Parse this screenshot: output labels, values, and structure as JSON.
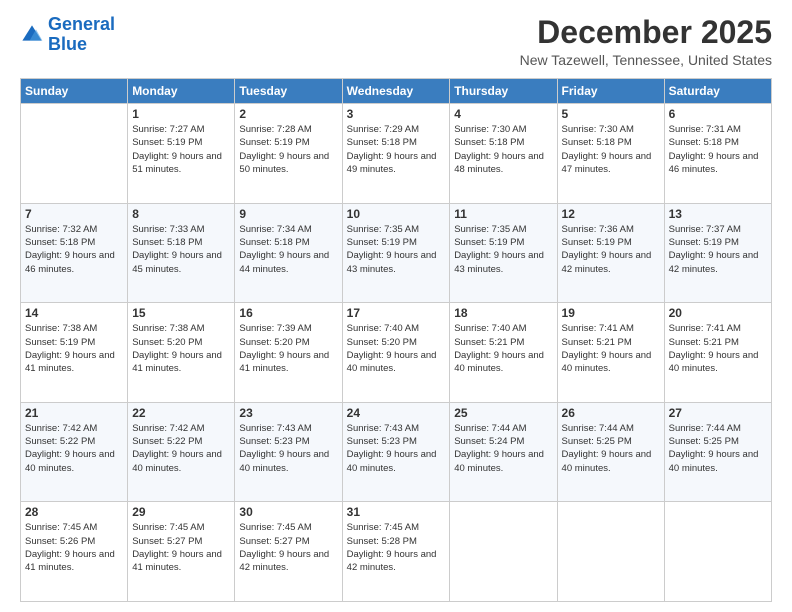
{
  "logo": {
    "line1": "General",
    "line2": "Blue"
  },
  "title": "December 2025",
  "subtitle": "New Tazewell, Tennessee, United States",
  "days_of_week": [
    "Sunday",
    "Monday",
    "Tuesday",
    "Wednesday",
    "Thursday",
    "Friday",
    "Saturday"
  ],
  "weeks": [
    [
      {
        "day": "",
        "sunrise": "",
        "sunset": "",
        "daylight": ""
      },
      {
        "day": "1",
        "sunrise": "Sunrise: 7:27 AM",
        "sunset": "Sunset: 5:19 PM",
        "daylight": "Daylight: 9 hours and 51 minutes."
      },
      {
        "day": "2",
        "sunrise": "Sunrise: 7:28 AM",
        "sunset": "Sunset: 5:19 PM",
        "daylight": "Daylight: 9 hours and 50 minutes."
      },
      {
        "day": "3",
        "sunrise": "Sunrise: 7:29 AM",
        "sunset": "Sunset: 5:18 PM",
        "daylight": "Daylight: 9 hours and 49 minutes."
      },
      {
        "day": "4",
        "sunrise": "Sunrise: 7:30 AM",
        "sunset": "Sunset: 5:18 PM",
        "daylight": "Daylight: 9 hours and 48 minutes."
      },
      {
        "day": "5",
        "sunrise": "Sunrise: 7:30 AM",
        "sunset": "Sunset: 5:18 PM",
        "daylight": "Daylight: 9 hours and 47 minutes."
      },
      {
        "day": "6",
        "sunrise": "Sunrise: 7:31 AM",
        "sunset": "Sunset: 5:18 PM",
        "daylight": "Daylight: 9 hours and 46 minutes."
      }
    ],
    [
      {
        "day": "7",
        "sunrise": "Sunrise: 7:32 AM",
        "sunset": "Sunset: 5:18 PM",
        "daylight": "Daylight: 9 hours and 46 minutes."
      },
      {
        "day": "8",
        "sunrise": "Sunrise: 7:33 AM",
        "sunset": "Sunset: 5:18 PM",
        "daylight": "Daylight: 9 hours and 45 minutes."
      },
      {
        "day": "9",
        "sunrise": "Sunrise: 7:34 AM",
        "sunset": "Sunset: 5:18 PM",
        "daylight": "Daylight: 9 hours and 44 minutes."
      },
      {
        "day": "10",
        "sunrise": "Sunrise: 7:35 AM",
        "sunset": "Sunset: 5:19 PM",
        "daylight": "Daylight: 9 hours and 43 minutes."
      },
      {
        "day": "11",
        "sunrise": "Sunrise: 7:35 AM",
        "sunset": "Sunset: 5:19 PM",
        "daylight": "Daylight: 9 hours and 43 minutes."
      },
      {
        "day": "12",
        "sunrise": "Sunrise: 7:36 AM",
        "sunset": "Sunset: 5:19 PM",
        "daylight": "Daylight: 9 hours and 42 minutes."
      },
      {
        "day": "13",
        "sunrise": "Sunrise: 7:37 AM",
        "sunset": "Sunset: 5:19 PM",
        "daylight": "Daylight: 9 hours and 42 minutes."
      }
    ],
    [
      {
        "day": "14",
        "sunrise": "Sunrise: 7:38 AM",
        "sunset": "Sunset: 5:19 PM",
        "daylight": "Daylight: 9 hours and 41 minutes."
      },
      {
        "day": "15",
        "sunrise": "Sunrise: 7:38 AM",
        "sunset": "Sunset: 5:20 PM",
        "daylight": "Daylight: 9 hours and 41 minutes."
      },
      {
        "day": "16",
        "sunrise": "Sunrise: 7:39 AM",
        "sunset": "Sunset: 5:20 PM",
        "daylight": "Daylight: 9 hours and 41 minutes."
      },
      {
        "day": "17",
        "sunrise": "Sunrise: 7:40 AM",
        "sunset": "Sunset: 5:20 PM",
        "daylight": "Daylight: 9 hours and 40 minutes."
      },
      {
        "day": "18",
        "sunrise": "Sunrise: 7:40 AM",
        "sunset": "Sunset: 5:21 PM",
        "daylight": "Daylight: 9 hours and 40 minutes."
      },
      {
        "day": "19",
        "sunrise": "Sunrise: 7:41 AM",
        "sunset": "Sunset: 5:21 PM",
        "daylight": "Daylight: 9 hours and 40 minutes."
      },
      {
        "day": "20",
        "sunrise": "Sunrise: 7:41 AM",
        "sunset": "Sunset: 5:21 PM",
        "daylight": "Daylight: 9 hours and 40 minutes."
      }
    ],
    [
      {
        "day": "21",
        "sunrise": "Sunrise: 7:42 AM",
        "sunset": "Sunset: 5:22 PM",
        "daylight": "Daylight: 9 hours and 40 minutes."
      },
      {
        "day": "22",
        "sunrise": "Sunrise: 7:42 AM",
        "sunset": "Sunset: 5:22 PM",
        "daylight": "Daylight: 9 hours and 40 minutes."
      },
      {
        "day": "23",
        "sunrise": "Sunrise: 7:43 AM",
        "sunset": "Sunset: 5:23 PM",
        "daylight": "Daylight: 9 hours and 40 minutes."
      },
      {
        "day": "24",
        "sunrise": "Sunrise: 7:43 AM",
        "sunset": "Sunset: 5:23 PM",
        "daylight": "Daylight: 9 hours and 40 minutes."
      },
      {
        "day": "25",
        "sunrise": "Sunrise: 7:44 AM",
        "sunset": "Sunset: 5:24 PM",
        "daylight": "Daylight: 9 hours and 40 minutes."
      },
      {
        "day": "26",
        "sunrise": "Sunrise: 7:44 AM",
        "sunset": "Sunset: 5:25 PM",
        "daylight": "Daylight: 9 hours and 40 minutes."
      },
      {
        "day": "27",
        "sunrise": "Sunrise: 7:44 AM",
        "sunset": "Sunset: 5:25 PM",
        "daylight": "Daylight: 9 hours and 40 minutes."
      }
    ],
    [
      {
        "day": "28",
        "sunrise": "Sunrise: 7:45 AM",
        "sunset": "Sunset: 5:26 PM",
        "daylight": "Daylight: 9 hours and 41 minutes."
      },
      {
        "day": "29",
        "sunrise": "Sunrise: 7:45 AM",
        "sunset": "Sunset: 5:27 PM",
        "daylight": "Daylight: 9 hours and 41 minutes."
      },
      {
        "day": "30",
        "sunrise": "Sunrise: 7:45 AM",
        "sunset": "Sunset: 5:27 PM",
        "daylight": "Daylight: 9 hours and 42 minutes."
      },
      {
        "day": "31",
        "sunrise": "Sunrise: 7:45 AM",
        "sunset": "Sunset: 5:28 PM",
        "daylight": "Daylight: 9 hours and 42 minutes."
      },
      {
        "day": "",
        "sunrise": "",
        "sunset": "",
        "daylight": ""
      },
      {
        "day": "",
        "sunrise": "",
        "sunset": "",
        "daylight": ""
      },
      {
        "day": "",
        "sunrise": "",
        "sunset": "",
        "daylight": ""
      }
    ]
  ]
}
